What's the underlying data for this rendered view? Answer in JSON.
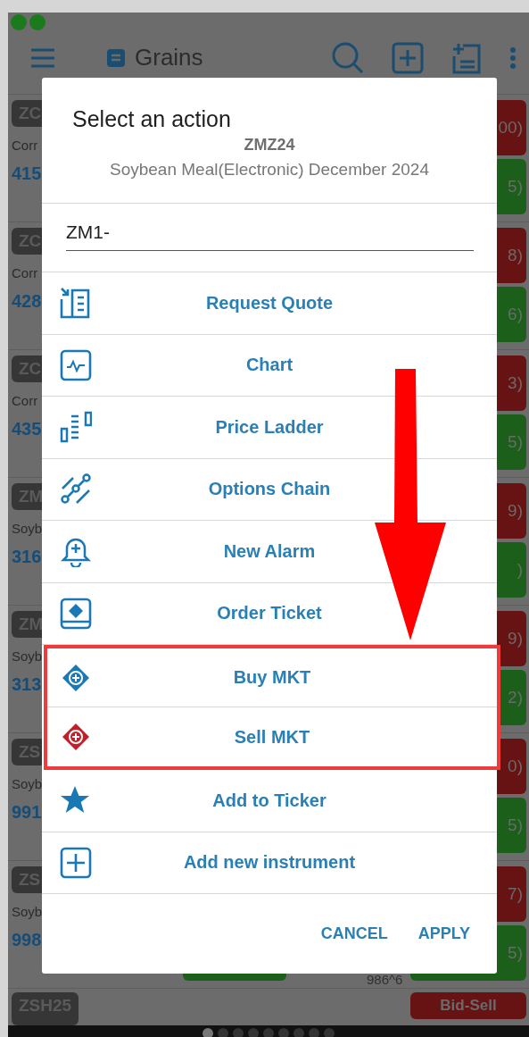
{
  "header": {
    "title": "Grains"
  },
  "rows": [
    {
      "symbol": "ZC",
      "name": "Corr",
      "price": "415",
      "bid": "00)",
      "ask": "5)"
    },
    {
      "symbol": "ZC",
      "name": "Corr",
      "price": "428",
      "bid": "8)",
      "ask": "6)"
    },
    {
      "symbol": "ZC",
      "name": "Corr",
      "price": "435",
      "bid": "3)",
      "ask": "5)"
    },
    {
      "symbol": "ZM",
      "name": "Soyb",
      "price": "316",
      "bid": "9)",
      "ask": ")"
    },
    {
      "symbol": "ZM",
      "name": "Soyb",
      "price": "313",
      "bid": "9)",
      "ask": "2)"
    },
    {
      "symbol": "ZS",
      "name": "Soyb",
      "price": "991",
      "bid": "0)",
      "ask": "5)"
    },
    {
      "symbol": "ZS",
      "name": "Soyb",
      "price": "998",
      "bid": "7)",
      "ask": "5)",
      "low": "986^6"
    }
  ],
  "last_row": {
    "symbol": "ZSH25",
    "bid": "Bid-Sell"
  },
  "dialog": {
    "title": "Select an action",
    "symbol": "ZMZ24",
    "description": "Soybean Meal(Electronic) December 2024",
    "field_value": "ZM1-",
    "actions": [
      {
        "label": "Request Quote",
        "kind": "quote",
        "highlighted": false
      },
      {
        "label": "Chart",
        "kind": "chart",
        "highlighted": false
      },
      {
        "label": "Price Ladder",
        "kind": "ladder",
        "highlighted": false
      },
      {
        "label": "Options Chain",
        "kind": "options",
        "highlighted": false
      },
      {
        "label": "New Alarm",
        "kind": "alarm",
        "highlighted": false
      },
      {
        "label": "Order Ticket",
        "kind": "ticket",
        "highlighted": false
      },
      {
        "label": "Buy MKT",
        "kind": "buy",
        "highlighted": true
      },
      {
        "label": "Sell MKT",
        "kind": "sell",
        "highlighted": true
      },
      {
        "label": "Add to Ticker",
        "kind": "star",
        "highlighted": false
      },
      {
        "label": "Add new instrument",
        "kind": "add",
        "highlighted": false
      }
    ],
    "buttons": [
      "CANCEL",
      "APPLY"
    ]
  },
  "pager": [
    {
      "selected": true
    },
    {
      "selected": false
    },
    {
      "selected": false
    },
    {
      "selected": false
    },
    {
      "selected": false
    },
    {
      "selected": false
    },
    {
      "selected": false
    },
    {
      "selected": false
    },
    {
      "selected": false
    }
  ]
}
